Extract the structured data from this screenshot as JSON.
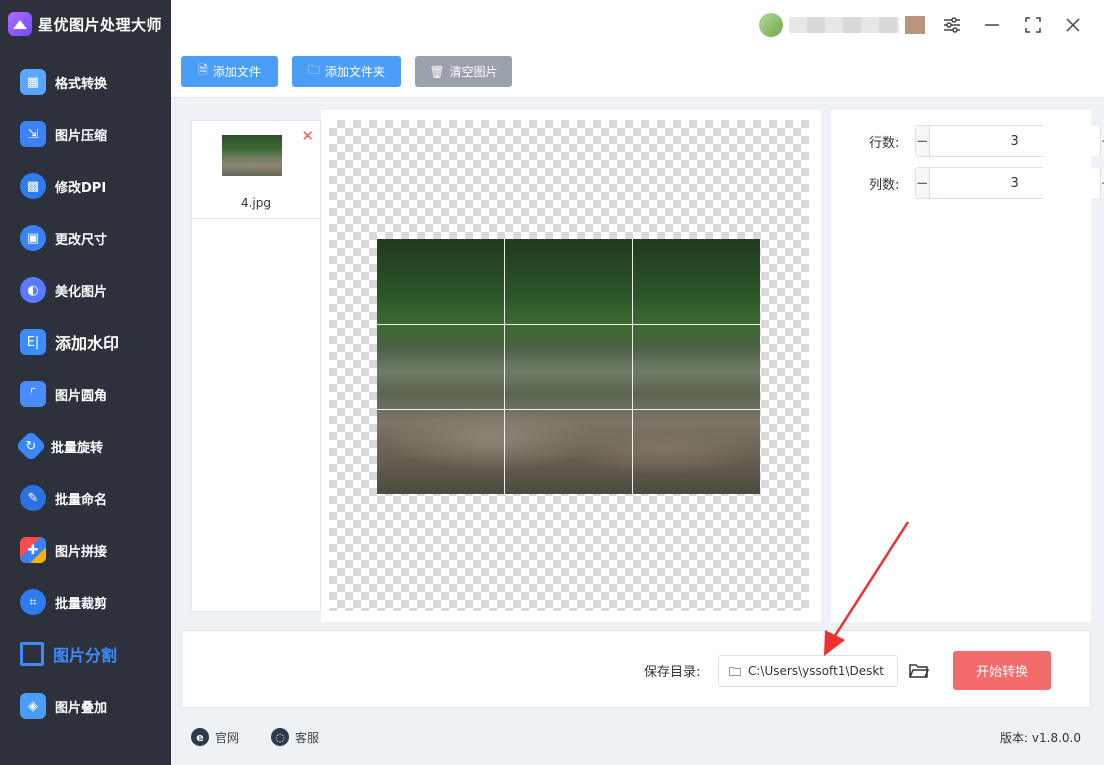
{
  "app": {
    "title": "星优图片处理大师"
  },
  "sidebar": {
    "items": [
      {
        "label": "格式转换",
        "icon": "image-convert-icon",
        "color": "#5aa6ff"
      },
      {
        "label": "图片压缩",
        "icon": "compress-icon",
        "color": "#3b82f6"
      },
      {
        "label": "修改DPI",
        "icon": "dpi-icon",
        "color": "#2f7cf0"
      },
      {
        "label": "更改尺寸",
        "icon": "resize-icon",
        "color": "#3b82f6"
      },
      {
        "label": "美化图片",
        "icon": "beautify-icon",
        "color": "#5a7bff"
      },
      {
        "label": "添加水印",
        "icon": "watermark-icon",
        "color": "#3b8cff"
      },
      {
        "label": "图片圆角",
        "icon": "round-corner-icon",
        "color": "#4a8cff"
      },
      {
        "label": "批量旋转",
        "icon": "rotate-icon",
        "color": "#3a86ff"
      },
      {
        "label": "批量命名",
        "icon": "rename-icon",
        "color": "#2b6fe0"
      },
      {
        "label": "图片拼接",
        "icon": "puzzle-icon",
        "color": "#3b82f6"
      },
      {
        "label": "批量裁剪",
        "icon": "crop-icon",
        "color": "#2f7cf0"
      },
      {
        "label": "图片分割",
        "icon": "split-icon",
        "color": "#3d8bff"
      },
      {
        "label": "图片叠加",
        "icon": "layers-icon",
        "color": "#4a9ef7"
      }
    ]
  },
  "toolbar": {
    "add_file": "添加文件",
    "add_folder": "添加文件夹",
    "clear_images": "清空图片"
  },
  "files": [
    {
      "name": "4.jpg"
    }
  ],
  "settings": {
    "rows_label": "行数:",
    "rows_value": "3",
    "cols_label": "列数:",
    "cols_value": "3"
  },
  "output": {
    "save_label": "保存目录:",
    "save_path": "C:\\Users\\yssoft1\\Deskt",
    "start_button": "开始转换"
  },
  "footer": {
    "website": "官网",
    "support": "客服",
    "version": "版本: v1.8.0.0"
  },
  "colors": {
    "sidebar_bg": "#2d313c",
    "primary": "#4a9ef7",
    "start": "#f36b6b",
    "active": "#3d8bff"
  }
}
